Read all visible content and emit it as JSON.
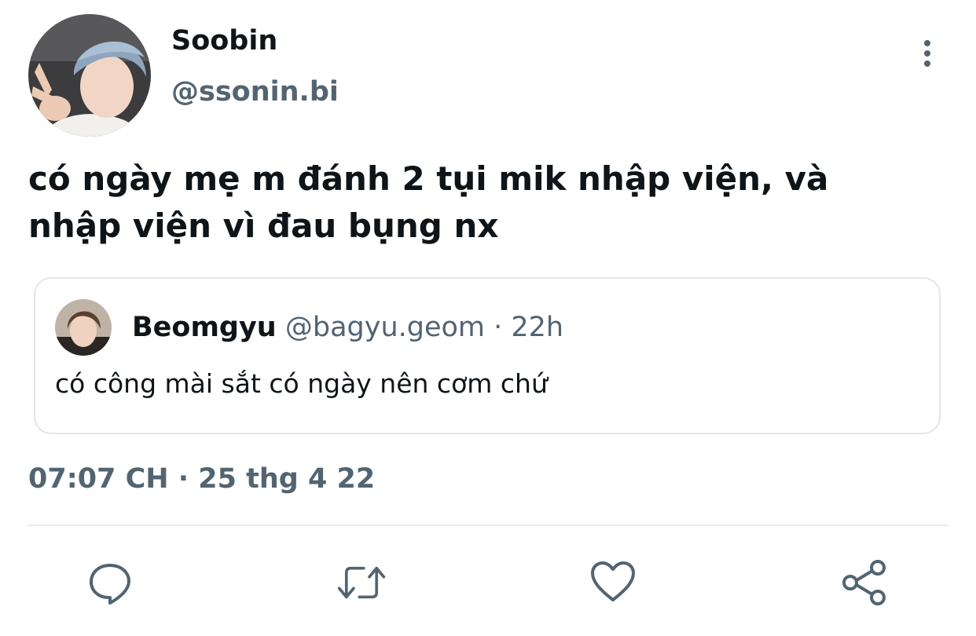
{
  "author": {
    "display_name": "Soobin",
    "handle": "@ssonin.bi"
  },
  "tweet": {
    "text": "có ngày mẹ m đánh 2 tụi mik nhập viện, và\nnhập viện vì đau bụng nx",
    "timestamp": "07:07 CH · 25 thg 4 22"
  },
  "quoted_tweet": {
    "display_name": "Beomgyu",
    "meta": "@bagyu.geom · 22h",
    "text": "có công mài sắt có ngày nên cơm chứ"
  },
  "icons": {
    "more": "more-vertical-icon",
    "reply": "reply-icon",
    "retweet": "retweet-icon",
    "like": "heart-icon",
    "share": "share-icon"
  },
  "colors": {
    "primary_text": "#0f1419",
    "secondary_text": "#536471",
    "border": "#e1e6ea"
  }
}
